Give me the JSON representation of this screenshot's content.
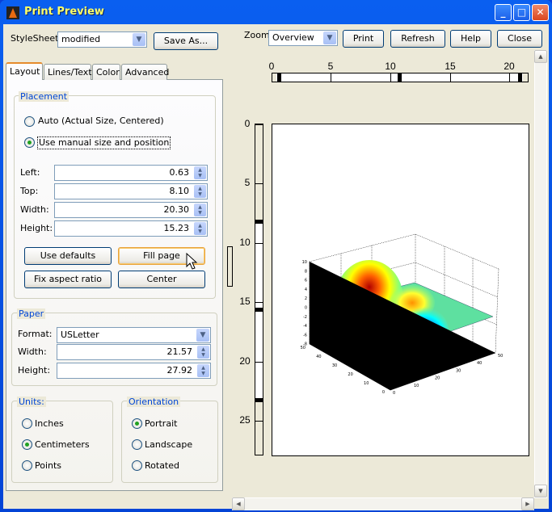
{
  "window": {
    "title": "Print Preview",
    "minimize": "_",
    "maximize": "□",
    "close": "✕"
  },
  "toolbar": {
    "stylesheet_label": "StyleSheet",
    "stylesheet_value": "modified",
    "save_as": "Save As...",
    "zoom_label": "Zoom",
    "zoom_value": "Overview",
    "print": "Print",
    "refresh": "Refresh",
    "help": "Help",
    "close": "Close"
  },
  "tabs": [
    "Layout",
    "Lines/Text",
    "Color",
    "Advanced"
  ],
  "placement": {
    "title": "Placement",
    "auto": "Auto (Actual Size, Centered)",
    "manual": "Use manual size and position",
    "selected": "manual",
    "fields": [
      {
        "label": "Left:",
        "value": "0.63"
      },
      {
        "label": "Top:",
        "value": "8.10"
      },
      {
        "label": "Width:",
        "value": "20.30"
      },
      {
        "label": "Height:",
        "value": "15.23"
      }
    ],
    "buttons": {
      "use_defaults": "Use defaults",
      "fill_page": "Fill page",
      "fix_aspect": "Fix aspect ratio",
      "center": "Center"
    }
  },
  "paper": {
    "title": "Paper",
    "format_label": "Format:",
    "format_value": "USLetter",
    "width_label": "Width:",
    "width_value": "21.57",
    "height_label": "Height:",
    "height_value": "27.92"
  },
  "units": {
    "title": "Units:",
    "options": [
      "Inches",
      "Centimeters",
      "Points"
    ],
    "selected": "Centimeters"
  },
  "orientation": {
    "title": "Orientation",
    "options": [
      "Portrait",
      "Landscape",
      "Rotated"
    ],
    "selected": "Portrait"
  },
  "rulers": {
    "horizontal_ticks": [
      "0",
      "5",
      "10",
      "15",
      "20"
    ],
    "vertical_ticks": [
      "0",
      "5",
      "10",
      "15",
      "20",
      "25"
    ]
  },
  "plot": {
    "z_ticks": [
      "10",
      "8",
      "6",
      "4",
      "2",
      "0",
      "-2",
      "-4",
      "-6",
      "-8"
    ],
    "x_ticks": [
      "0",
      "10",
      "20",
      "30",
      "40",
      "50"
    ],
    "y_ticks": [
      "0",
      "10",
      "20",
      "30",
      "40",
      "50"
    ],
    "colormap": [
      "#00008f",
      "#0080ff",
      "#00ffff",
      "#80ff80",
      "#ffff00",
      "#ff8000",
      "#800000"
    ]
  }
}
